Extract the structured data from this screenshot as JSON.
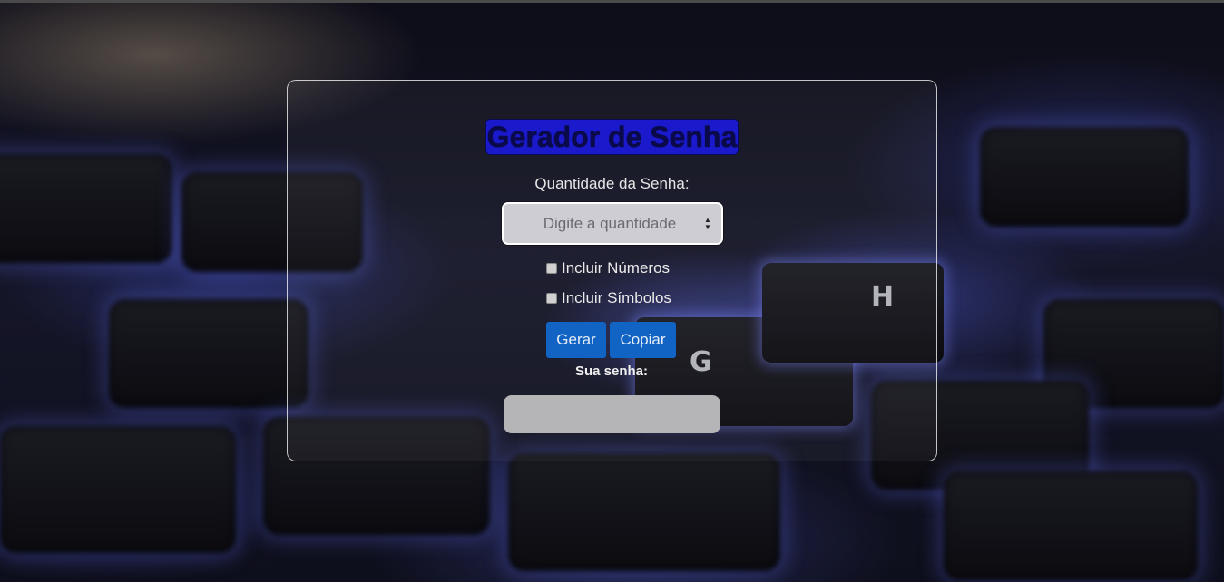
{
  "title": "Gerador de Senha",
  "quantity": {
    "label": "Quantidade da Senha:",
    "placeholder": "Digite a quantidade",
    "value": ""
  },
  "options": [
    {
      "label": "Incluir Números",
      "checked": false
    },
    {
      "label": "Incluir Símbolos",
      "checked": false
    }
  ],
  "buttons": {
    "generate": "Gerar",
    "copy": "Copiar"
  },
  "result": {
    "label": "Sua senha:",
    "value": ""
  },
  "background_keys": [
    "G",
    "H"
  ],
  "colors": {
    "title_bg": "#1a1acc",
    "button_bg": "#1163c4",
    "result_bg": "#b5b5b8"
  }
}
